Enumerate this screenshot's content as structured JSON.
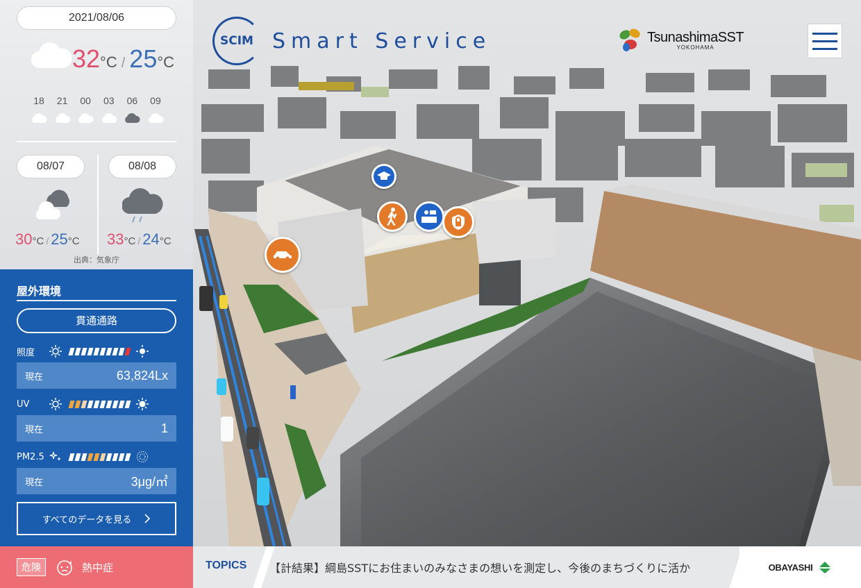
{
  "header": {
    "logo_mark": "SCIM",
    "title": "Smart Service",
    "partner_logo": "TsunashimaSST",
    "partner_sub": "YOKOHAMA"
  },
  "weather": {
    "date": "2021/08/06",
    "today": {
      "high": "32",
      "low": "25",
      "unit": "°C",
      "icon": "cloud-icon"
    },
    "hours": [
      "18",
      "21",
      "00",
      "03",
      "06",
      "09"
    ],
    "hour_icons": [
      "cloud-icon",
      "cloud-icon",
      "cloud-icon",
      "cloud-icon",
      "dark-cloud-icon",
      "cloud-icon"
    ],
    "forecast": [
      {
        "date": "08/07",
        "high": "30",
        "low": "25",
        "unit": "°C",
        "icon": "sun-behind-cloud-icon"
      },
      {
        "date": "08/08",
        "high": "33",
        "low": "24",
        "unit": "°C",
        "icon": "rain-cloud-icon"
      }
    ],
    "source": "出典：気象庁"
  },
  "environment": {
    "title": "屋外環境",
    "location_button": "貫通通路",
    "metrics": [
      {
        "label": "照度",
        "row_label": "現在",
        "value": "63,824Lx",
        "level": 10,
        "segments": 10
      },
      {
        "label": "UV",
        "row_label": "現在",
        "value": "1",
        "level": 2,
        "segments": 10
      },
      {
        "label": "PM2.5",
        "row_label": "現在",
        "value": "3μg/㎥",
        "level": 5,
        "segments": 10
      }
    ],
    "all_data_button": "すべてのデータを見る"
  },
  "alert": {
    "badge": "危険",
    "text": "熱中症"
  },
  "topics": {
    "label": "TOPICS",
    "text": "【計結果】綱島SSTにお住まいのみなさまの想いを測定し、今後のまちづくりに活か"
  },
  "footer": {
    "sponsor": "OBAYASHI"
  },
  "map_markers": [
    "education-icon",
    "walking-person-icon",
    "reception-icon",
    "security-lock-icon",
    "car-icon"
  ],
  "colors": {
    "brand_blue": "#1f4f9a",
    "panel_blue": "#1a5cae",
    "hot_temp": "#e0506e",
    "cold_temp": "#3d6fb6",
    "alert": "#ee6d74",
    "marker_orange": "#e37a2a"
  }
}
